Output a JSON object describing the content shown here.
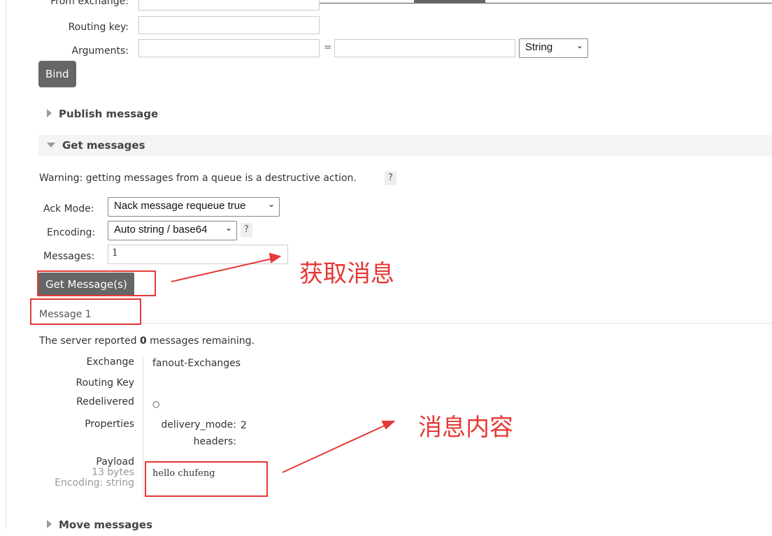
{
  "bind_form": {
    "from_exchange_label": "From exchange:",
    "routing_key_label": "Routing key:",
    "arguments_label": "Arguments:",
    "equals": "=",
    "arg_type": "String",
    "bind_button": "Bind"
  },
  "sections": {
    "publish": "Publish message",
    "get": "Get messages",
    "move": "Move messages"
  },
  "get_messages": {
    "warning": "Warning: getting messages from a queue is a destructive action.",
    "help": "?",
    "ack_mode_label": "Ack Mode:",
    "ack_mode": "Nack message requeue true",
    "encoding_label": "Encoding:",
    "encoding": "Auto string / base64",
    "messages_label": "Messages:",
    "messages_value": "1",
    "get_button": "Get Message(s)"
  },
  "message": {
    "title": "Message 1",
    "remaining_prefix": "The server reported ",
    "remaining_count": "0",
    "remaining_suffix": " messages remaining.",
    "exchange_label": "Exchange",
    "exchange": "fanout-Exchanges",
    "routing_key_label": "Routing Key",
    "redelivered_label": "Redelivered",
    "redelivered": "○",
    "properties_label": "Properties",
    "delivery_mode_label": "delivery_mode:",
    "delivery_mode": "2",
    "headers_label": "headers:",
    "payload_label": "Payload",
    "payload_size": "13 bytes",
    "payload_encoding": "Encoding: string",
    "payload": "hello chufeng"
  },
  "annotations": {
    "get": "获取消息",
    "content": "消息内容",
    "color": "#e53935"
  }
}
